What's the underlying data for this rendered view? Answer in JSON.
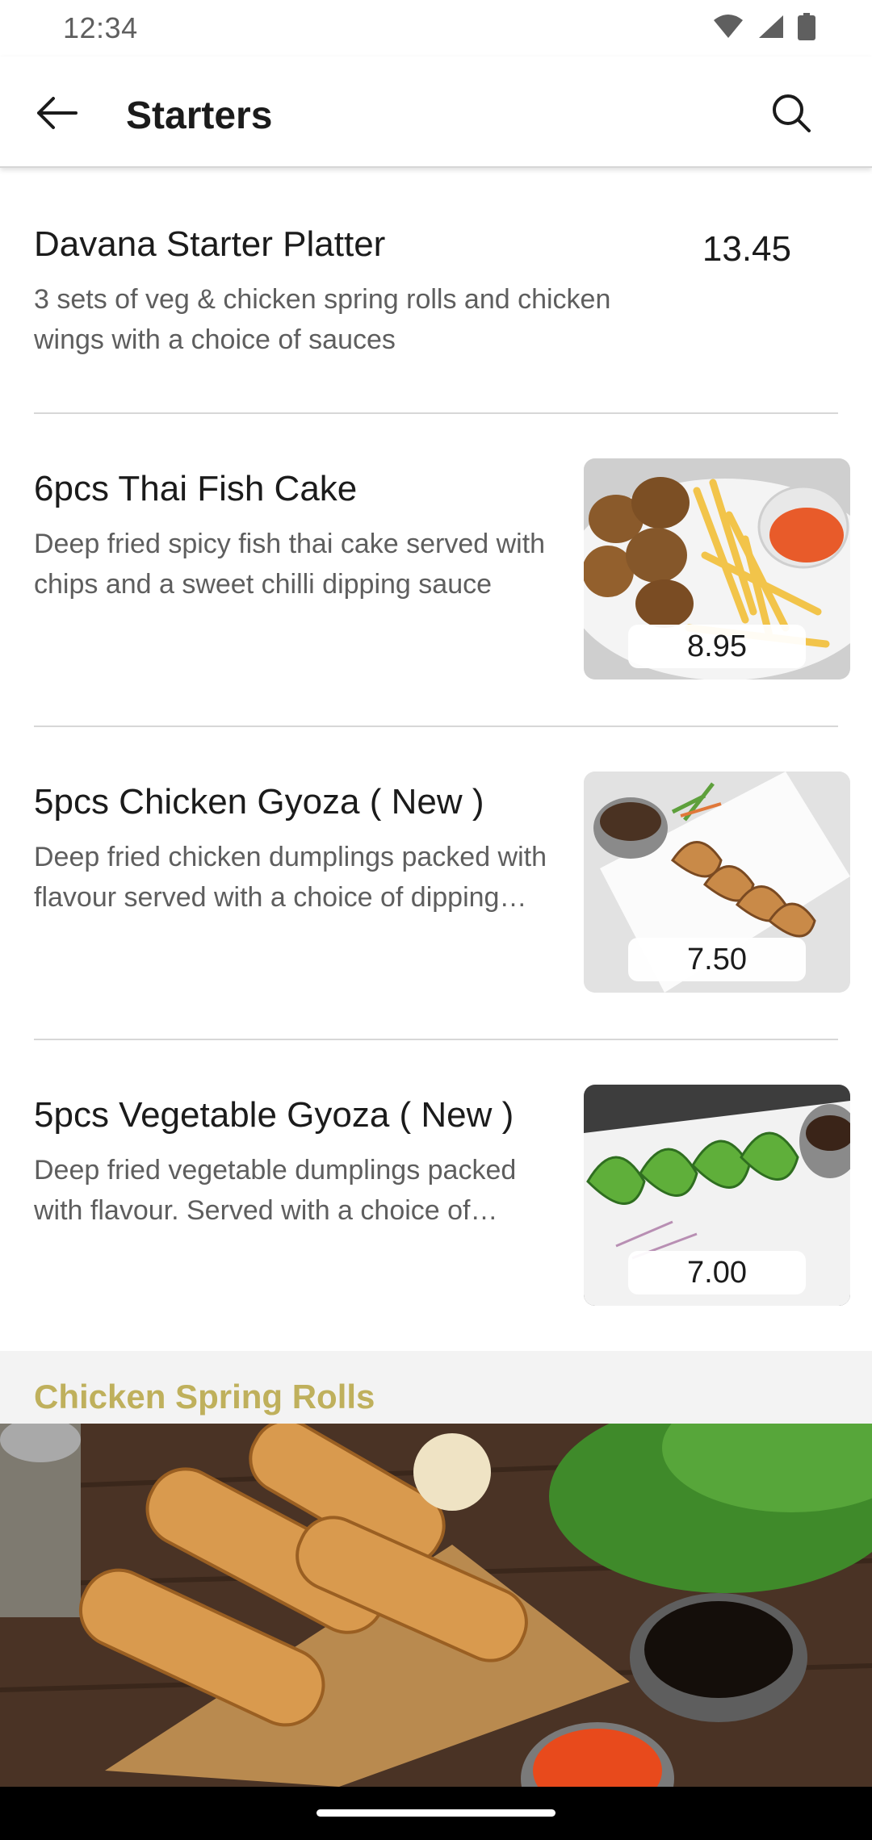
{
  "status_bar": {
    "time": "12:34",
    "icons": [
      "wifi-icon",
      "signal-icon",
      "battery-icon"
    ]
  },
  "app_bar": {
    "title": "Starters",
    "back_icon": "arrow-left-icon",
    "search_icon": "search-icon"
  },
  "items": [
    {
      "name": "Davana Starter Platter",
      "description": "3 sets of veg & chicken spring rolls and chicken wings with a choice of sauces",
      "price": "13.45",
      "has_image": false
    },
    {
      "name": "6pcs Thai Fish Cake",
      "description": "Deep fried spicy fish thai cake served with chips and a sweet chilli dipping sauce",
      "price": "8.95",
      "has_image": true
    },
    {
      "name": "5pcs Chicken Gyoza ( New )",
      "description": "Deep fried chicken dumplings packed with flavour served with a choice of dipping sauce",
      "price": "7.50",
      "has_image": true
    },
    {
      "name": "5pcs Vegetable Gyoza ( New )",
      "description": "Deep fried vegetable dumplings packed with flavour. Served with a choice of dipping sauce",
      "price": "7.00",
      "has_image": true
    }
  ],
  "section": {
    "title": "Chicken Spring Rolls"
  },
  "colors": {
    "section_title": "#bfb05c",
    "divider": "#d7d7d7",
    "text_primary": "#1b1b1b",
    "text_secondary": "#5e5e5e"
  }
}
